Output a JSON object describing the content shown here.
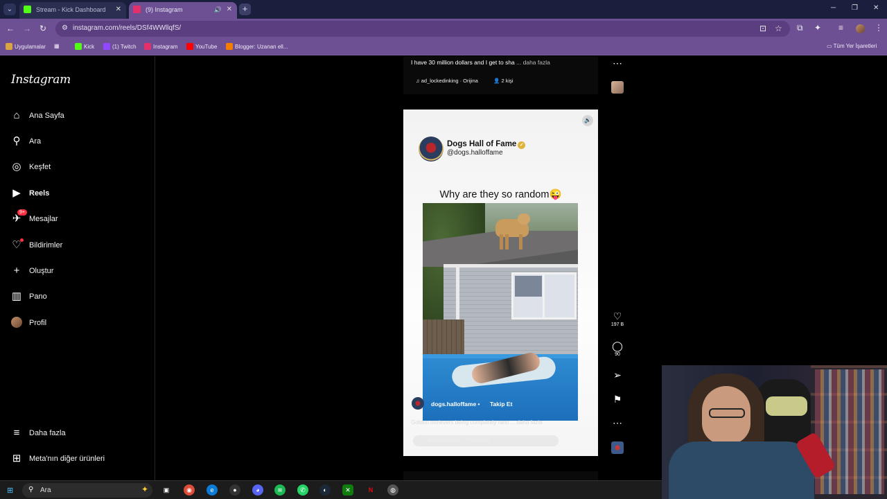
{
  "browser": {
    "tabs": [
      {
        "title": "Stream - Kick Dashboard",
        "favicon_color": "#53fc18"
      },
      {
        "title": "(9) Instagram",
        "favicon_color": "#e1306c"
      }
    ],
    "new_tab_label": "+",
    "url": "instagram.com/reels/DSf4WWllqfS/",
    "bookmarks": [
      {
        "label": "Uygulamalar",
        "color": "#d9a441"
      },
      {
        "label": "Kick",
        "color": "#53fc18"
      },
      {
        "label": "(1) Twitch",
        "color": "#9146ff"
      },
      {
        "label": "Instagram",
        "color": "#e1306c"
      },
      {
        "label": "YouTube",
        "color": "#ff0000"
      },
      {
        "label": "Blogger: Uzanan ell...",
        "color": "#f57d00"
      }
    ],
    "all_bookmarks_label": "Tüm Yer İşaretleri"
  },
  "instagram": {
    "logo": "Instagram",
    "nav": [
      {
        "label": "Ana Sayfa",
        "icon": "home-icon"
      },
      {
        "label": "Ara",
        "icon": "search-icon"
      },
      {
        "label": "Keşfet",
        "icon": "compass-icon"
      },
      {
        "label": "Reels",
        "icon": "reels-icon"
      },
      {
        "label": "Mesajlar",
        "icon": "messenger-icon",
        "badge": "9+"
      },
      {
        "label": "Bildirimler",
        "icon": "heart-icon"
      },
      {
        "label": "Oluştur",
        "icon": "plus-icon"
      },
      {
        "label": "Pano",
        "icon": "dashboard-icon"
      },
      {
        "label": "Profil",
        "icon": "avatar"
      }
    ],
    "more_label": "Daha fazla",
    "meta_label": "Meta'nın diğer ürünleri"
  },
  "prev_reel": {
    "caption": "I have 30 million dollars and I get to sha",
    "more": "... daha fazla",
    "audio": "♫ ad_lockedinking · Orijina",
    "people": "2 kişi"
  },
  "reel": {
    "account_name": "Dogs Hall of Fame",
    "account_handle": "@dogs.halloffame",
    "title": "Why are they so random😜",
    "overlay_user": "dogs.halloffame",
    "follow_label": "Takip Et",
    "caption": "Golden retrievers being completely ranc ... daha fazla",
    "audio": "♫ dogs.halloffame · Orijinal ses"
  },
  "actions": {
    "likes": "197 B",
    "comments": "90"
  },
  "taskbar": {
    "search_placeholder": "Ara"
  }
}
